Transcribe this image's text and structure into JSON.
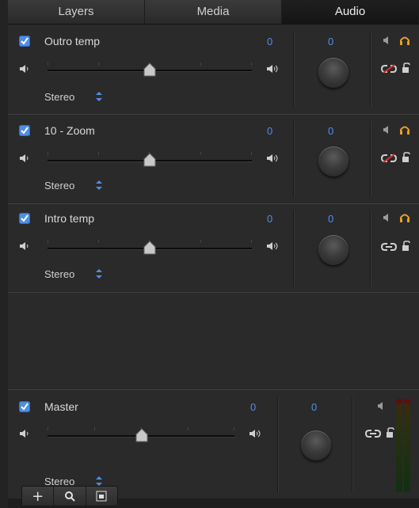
{
  "tabs": [
    {
      "label": "Layers"
    },
    {
      "label": "Media"
    },
    {
      "label": "Audio"
    }
  ],
  "tracks": [
    {
      "name": "Outro temp",
      "level": "0",
      "pan": "0",
      "channel": "Stereo",
      "checked": true,
      "linked": false
    },
    {
      "name": "10 - Zoom",
      "level": "0",
      "pan": "0",
      "channel": "Stereo",
      "checked": true,
      "linked": false
    },
    {
      "name": "Intro temp",
      "level": "0",
      "pan": "0",
      "channel": "Stereo",
      "checked": true,
      "linked": true
    }
  ],
  "master": {
    "name": "Master",
    "level": "0",
    "pan": "0",
    "channel": "Stereo",
    "checked": true
  },
  "toolbar": {
    "add": "+",
    "search": "search-icon",
    "view": "view-icon"
  },
  "colors": {
    "accent": "#4f8fe8",
    "solo": "#e8a020",
    "unlink": "#d03030"
  }
}
